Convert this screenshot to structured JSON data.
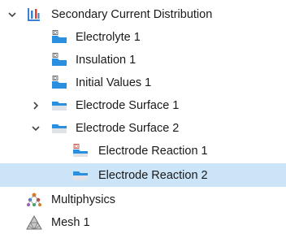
{
  "tree": {
    "root": {
      "label": "Secondary Current Distribution",
      "expanded": true,
      "icon": "secondary-current-icon"
    },
    "electrolyte": {
      "label": "Electrolyte 1",
      "icon": "domain-feature-icon"
    },
    "insulation": {
      "label": "Insulation 1",
      "icon": "boundary-feature-icon"
    },
    "initial_values": {
      "label": "Initial Values 1",
      "icon": "domain-feature-icon"
    },
    "surface1": {
      "label": "Electrode Surface 1",
      "expanded": false,
      "icon": "electrode-surface-icon"
    },
    "surface2": {
      "label": "Electrode Surface 2",
      "expanded": true,
      "icon": "electrode-surface-icon"
    },
    "reaction1": {
      "label": "Electrode Reaction 1",
      "icon": "electrode-reaction-default-icon"
    },
    "reaction2": {
      "label": "Electrode Reaction 2",
      "icon": "electrode-reaction-icon",
      "selected": true
    },
    "multiphysics": {
      "label": "Multiphysics",
      "icon": "multiphysics-icon"
    },
    "mesh": {
      "label": "Mesh 1",
      "icon": "mesh-icon"
    }
  },
  "colors": {
    "selection": "#cce4f7",
    "folder_blue": "#2b8fe0",
    "caret": "#444444"
  }
}
